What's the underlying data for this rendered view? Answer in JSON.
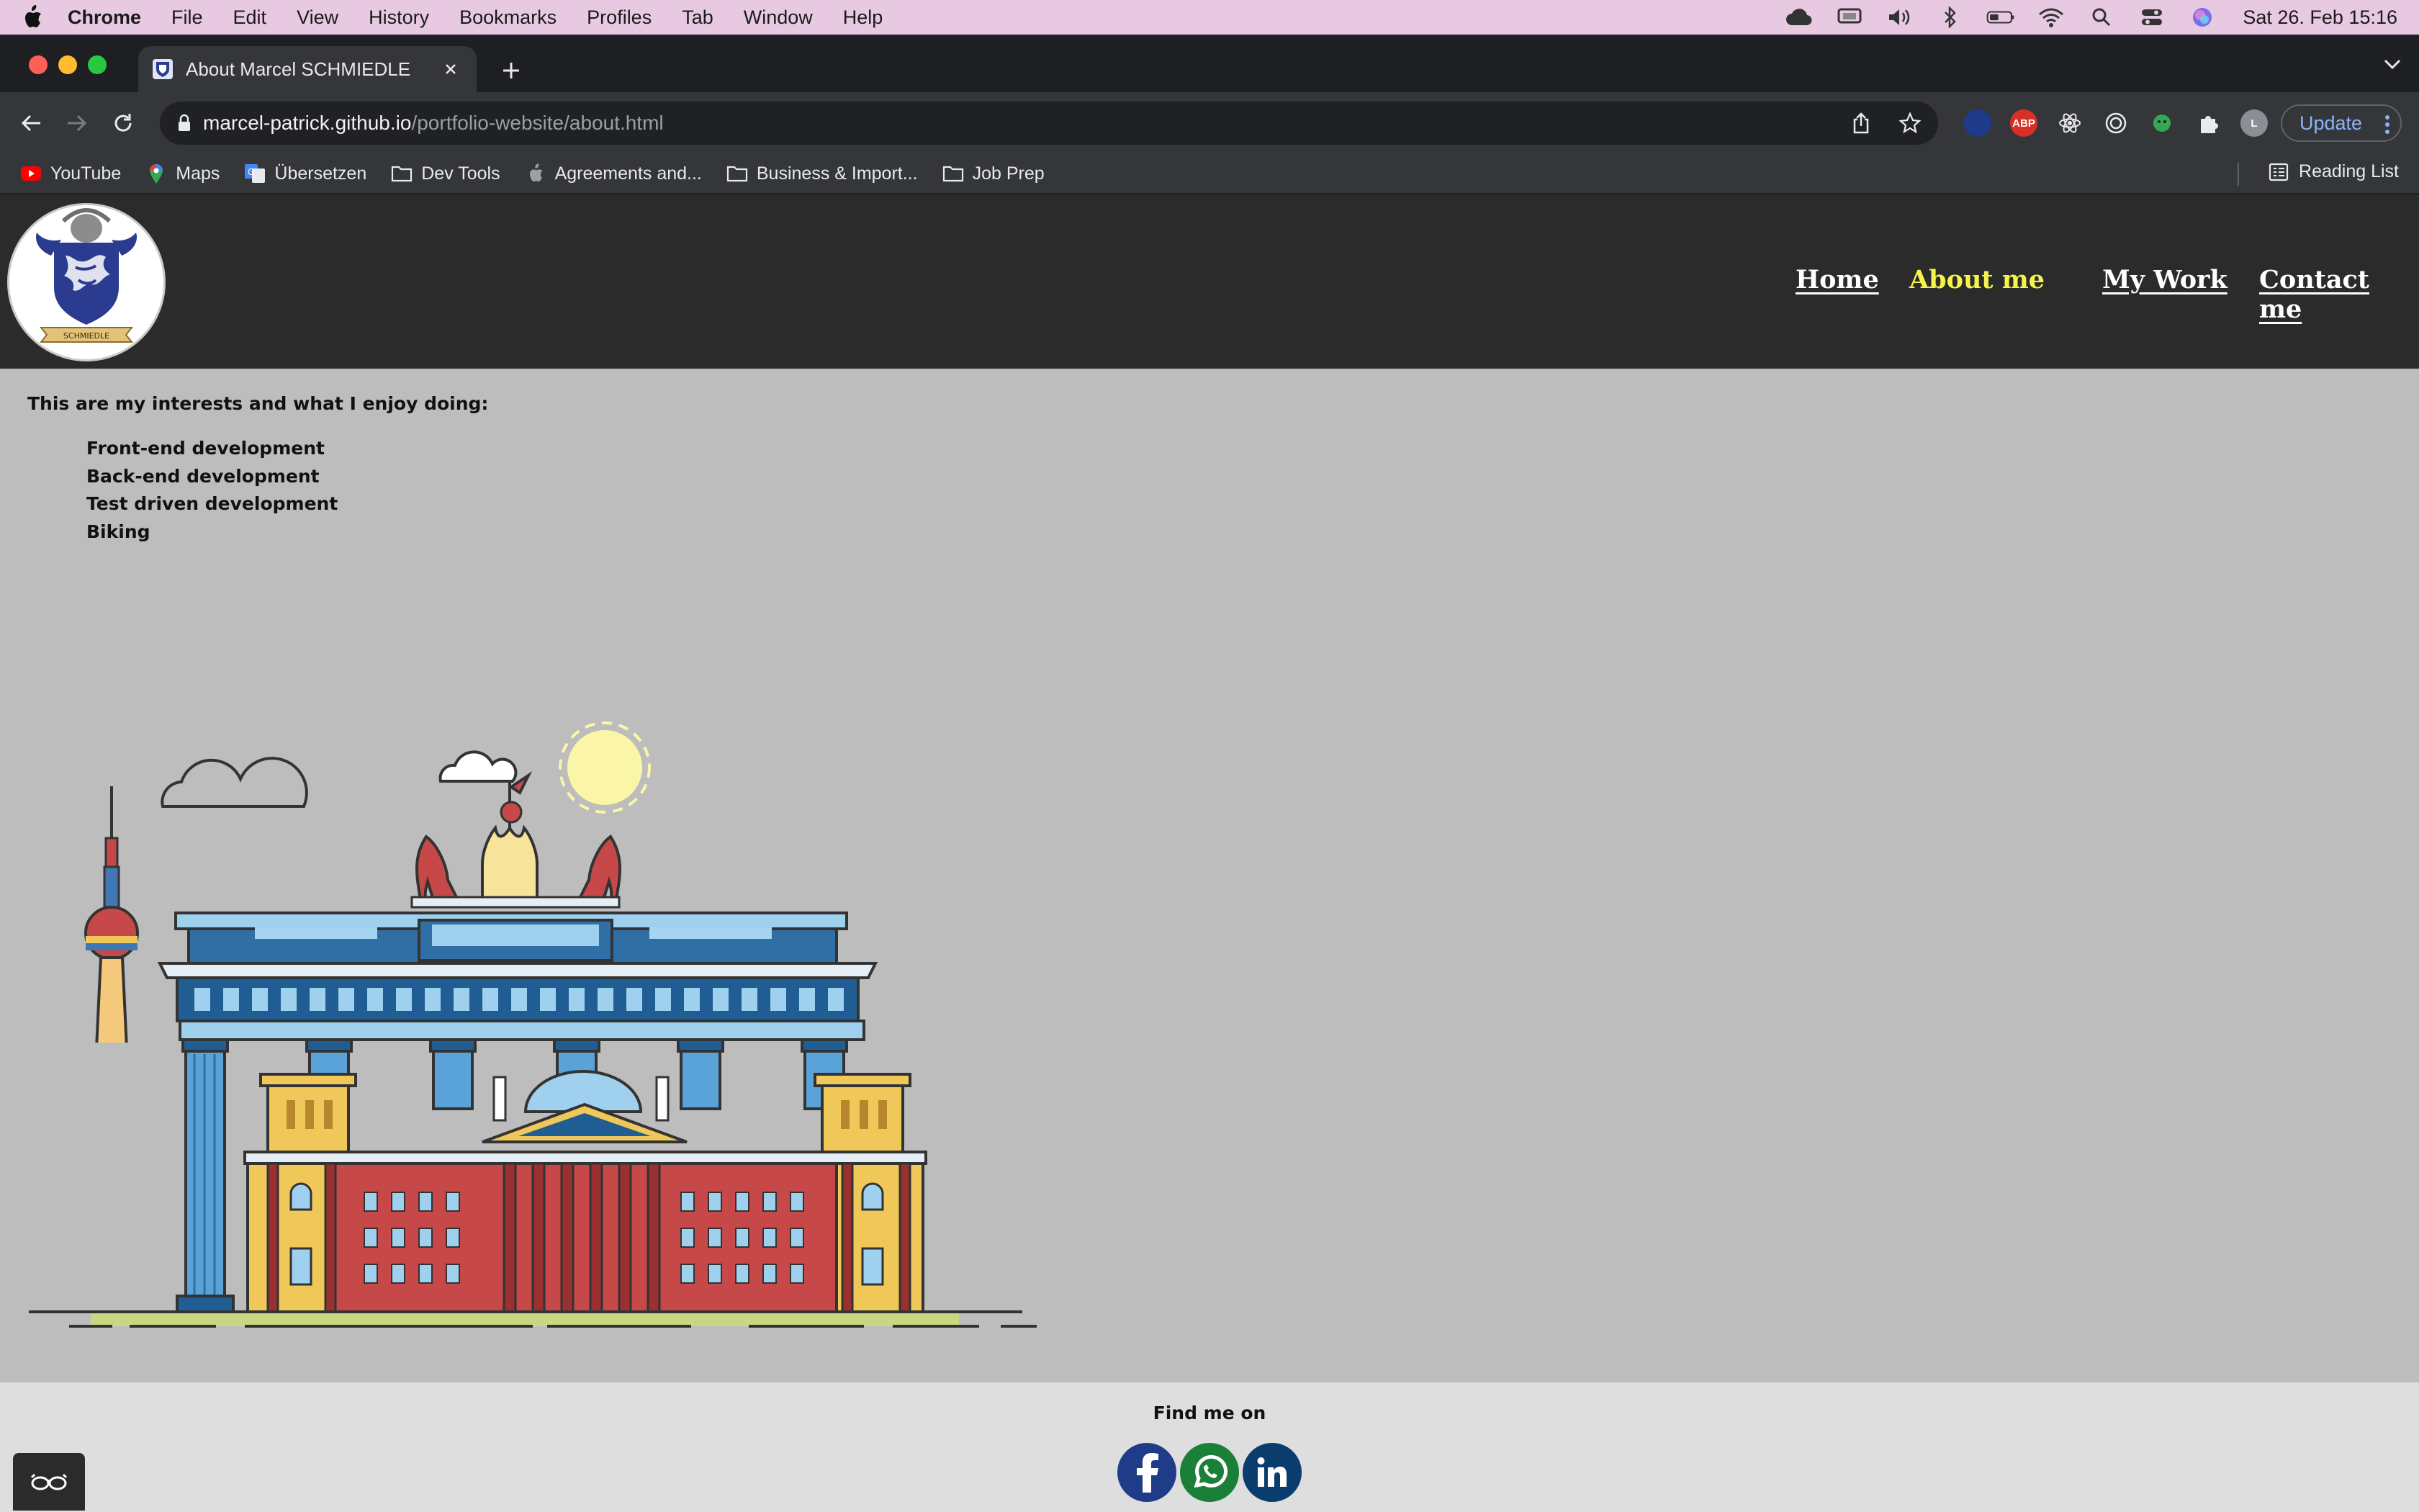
{
  "menubar": {
    "app": "Chrome",
    "items": [
      "File",
      "Edit",
      "View",
      "History",
      "Bookmarks",
      "Profiles",
      "Tab",
      "Window",
      "Help"
    ],
    "clock": "Sat 26. Feb  15:16"
  },
  "browser": {
    "tab_title": "About Marcel SCHMIEDLE",
    "url_host": "marcel-patrick.github.io",
    "url_path": "/portfolio-website/about.html",
    "update_label": "Update",
    "profile_initial": "L",
    "ext_abp": "ABP",
    "bookmarks": [
      "YouTube",
      "Maps",
      "Übersetzen",
      "Dev Tools",
      "Agreements and...",
      "Business & Import...",
      "Job Prep"
    ],
    "reading_list": "Reading List"
  },
  "site": {
    "nav": {
      "home": "Home",
      "about": "About me",
      "work": "My Work",
      "contact": "Contact me"
    },
    "logo_text": "SCHMIEDLE",
    "intro": "This are my interests and what I enjoy doing:",
    "interests": [
      "Front-end development",
      "Back-end development",
      "Test driven development",
      "Biking"
    ],
    "footer_title": "Find me on",
    "social": [
      "facebook-icon",
      "whatsapp-icon",
      "linkedin-icon"
    ]
  },
  "colors": {
    "nav_active": "#f6f44a",
    "header_bg": "#2b2b2b",
    "content_bg": "#bdbdbd",
    "footer_bg": "#dedede"
  }
}
